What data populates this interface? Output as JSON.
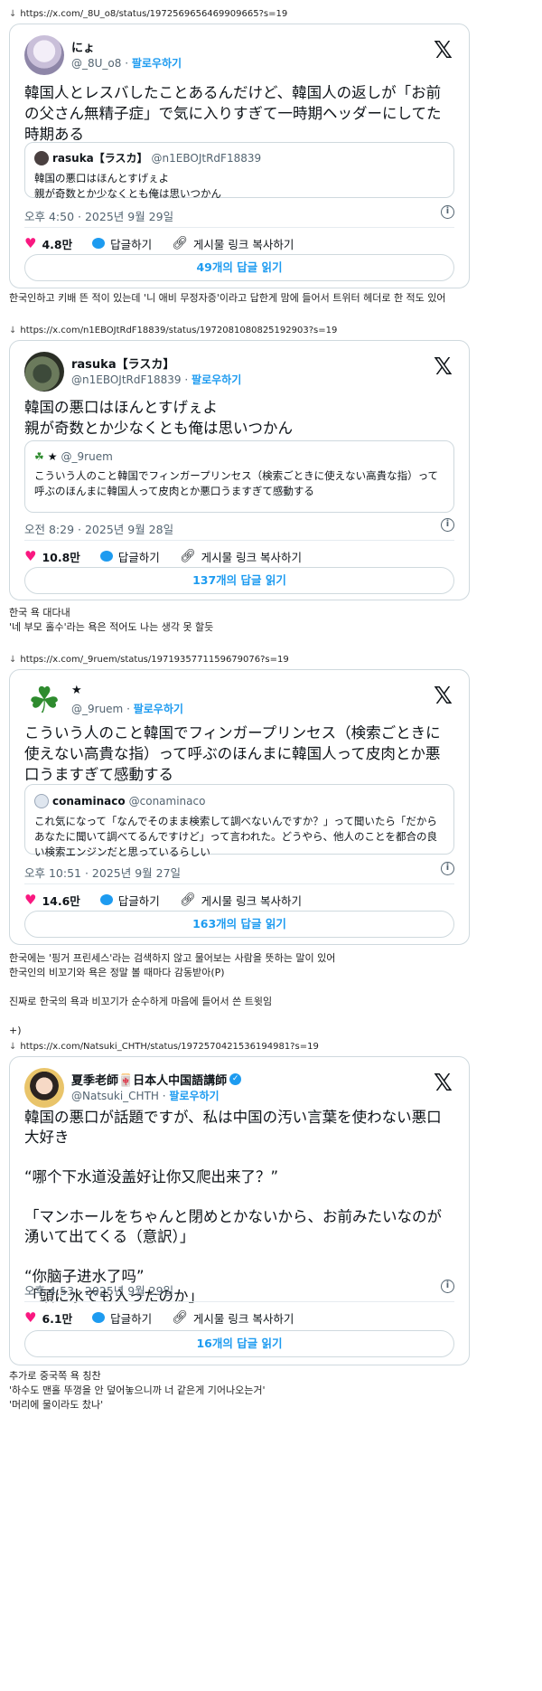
{
  "posts": [
    {
      "url": "https://x.com/_8U_o8/status/1972569656469909665?s=19",
      "name": "にょ",
      "handle": "@_8U_o8",
      "follow": "팔로우하기",
      "text": "韓国人とレスバしたことあるんだけど、韓国人の返しが「お前の父さん無精子症」で気に入りすぎて一時期ヘッダーにしてた時期ある",
      "quote": {
        "name": "rasuka【ラスカ】",
        "handle": "@n1EBOJtRdF18839",
        "text": "韓国の悪口はほんとすげぇよ\n親が奇数とか少なくとも俺は思いつかん"
      },
      "time": "오후 4:50 · 2025년 9월 29일",
      "likes": "4.8만",
      "reply_label": "답글하기",
      "copy_label": "게시물 링크 복사하기",
      "replies_button": "49개의 답글 읽기",
      "caption": [
        "한국인하고 키배 뜬 적이 있는데 '니 애비 무정자증'이라고 답한게 맘에 들어서 트위터 헤더로 한 적도 있어"
      ]
    },
    {
      "url": "https://x.com/n1EBOJtRdF18839/status/1972081080825192903?s=19",
      "name": "rasuka【ラスカ】",
      "handle": "@n1EBOJtRdF18839",
      "follow": "팔로우하기",
      "text": "韓国の悪口はほんとすげぇよ\n親が奇数とか少なくとも俺は思いつかん",
      "quote": {
        "name": "★",
        "handle": "@_9ruem",
        "text": "こういう人のこと韓国でフィンガープリンセス（検索ごときに使えない高貴な指）って呼ぶのほんまに韓国人って皮肉とか悪口うますぎて感動する"
      },
      "time": "오전 8:29 · 2025년 9월 28일",
      "likes": "10.8만",
      "reply_label": "답글하기",
      "copy_label": "게시물 링크 복사하기",
      "replies_button": "137개의 답글 읽기",
      "caption": [
        "한국 욕 대다내",
        "'네 부모 홀수'라는 욕은 적어도 나는 생각 못 할듯"
      ]
    },
    {
      "url": "https://x.com/_9ruem/status/1971935771159679076?s=19",
      "name": "★",
      "handle": "@_9ruem",
      "follow": "팔로우하기",
      "text": "こういう人のこと韓国でフィンガープリンセス（検索ごときに使えない高貴な指）って呼ぶのほんまに韓国人って皮肉とか悪口うますぎて感動する",
      "quote": {
        "name": "conaminaco",
        "handle": "@conaminaco",
        "text": "これ気になって「なんでそのまま検索して調べないんですか？」って聞いたら「だからあなたに聞いて調べてるんですけど」って言われた。どうやら、他人のことを都合の良い検索エンジンだと思っているらしい"
      },
      "time": "오후 10:51 · 2025년 9월 27일",
      "likes": "14.6만",
      "reply_label": "답글하기",
      "copy_label": "게시물 링크 복사하기",
      "replies_button": "163개의 답글 읽기",
      "caption": [
        "한국에는 '핑거 프린세스'라는 검색하지 않고 물어보는 사람을 뜻하는 말이 있어",
        "한국인의 비꼬기와 욕은 정말 볼 때마다 감동받아(P)",
        "",
        "진짜로 한국의 욕과 비꼬기가 순수하게 마음에 들어서 쓴 트윗임",
        "",
        "+)"
      ]
    },
    {
      "url": "https://x.com/Natsuki_CHTH/status/1972570421536194981?s=19",
      "name": "夏季老師🀄日本人中国語講師",
      "handle": "@Natsuki_CHTH",
      "follow": "팔로우하기",
      "text": "韓国の悪口が話題ですが、私は中国の汚い言葉を使わない悪口大好き\n\n“哪个下水道没盖好让你又爬出来了？”\n\n「マンホールをちゃんと閉めとかないから、お前みたいなのが湧いて出てくる（意訳）」\n\n“你脑子进水了吗”\n「頭に水でも入ったのか」",
      "time": "오후 4:53 · 2025년 9월 29일",
      "likes": "6.1만",
      "reply_label": "답글하기",
      "copy_label": "게시물 링크 복사하기",
      "replies_button": "16개의 답글 읽기",
      "caption": [
        "추가로 중국쪽 욕 칭찬",
        "'하수도 맨홀 뚜껑을 안 덮어놓으니까 너 같은게 기어나오는거'",
        "'머리에 물이라도 찼나'"
      ]
    }
  ],
  "colors": {
    "accent": "#1d9bf0",
    "heart": "#f91880",
    "border": "#cfd9de",
    "muted": "#536471"
  }
}
